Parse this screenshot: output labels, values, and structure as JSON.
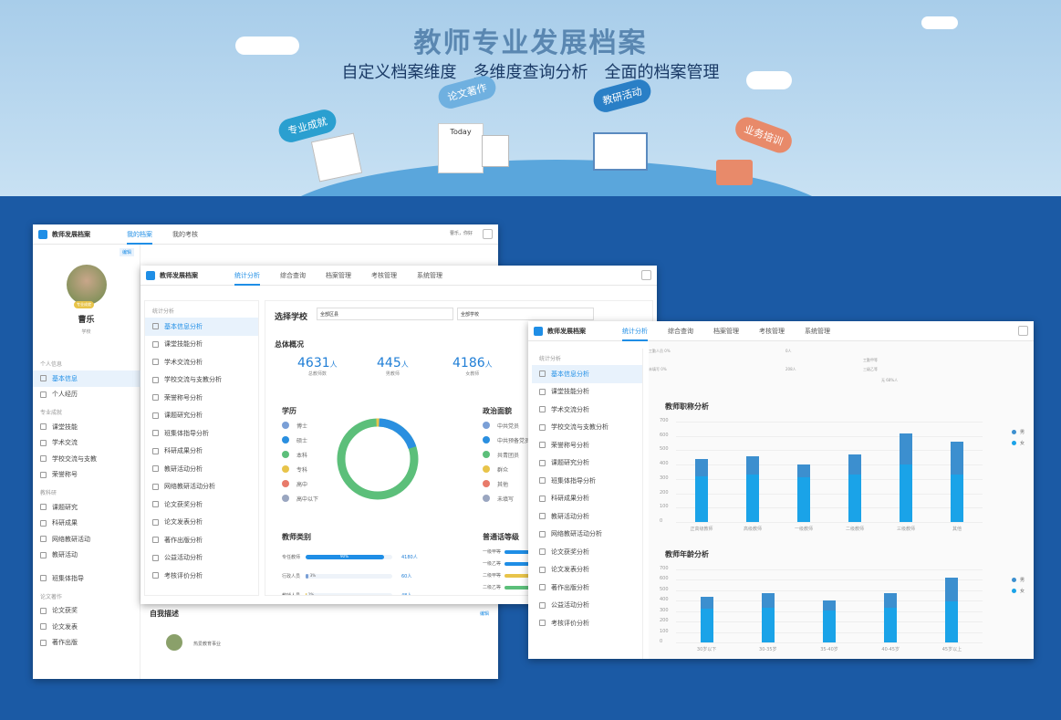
{
  "hero": {
    "title": "教师专业发展档案",
    "subtitle": "自定义档案维度　多维度查询分析　全面的档案管理",
    "bubbles": [
      "论文著作",
      "教研活动",
      "专业成就",
      "业务培训"
    ],
    "today": "Today"
  },
  "win1": {
    "brand": "教师发展档案",
    "tabs": [
      "我的档案",
      "我的考核"
    ],
    "user": "曹乐，你好",
    "tag": "编辑",
    "badge": "专业成就",
    "name": "曹乐",
    "school": "学校",
    "sections": [
      {
        "title": "个人信息",
        "items": [
          "基本信息",
          "个人经历"
        ]
      },
      {
        "title": "专业成就",
        "items": [
          "课堂技能",
          "学术交流",
          "学校交流与支教",
          "荣誉称号"
        ]
      },
      {
        "title": "教科研",
        "items": [
          "课题研究",
          "科研成果",
          "网络教研活动",
          "教研活动"
        ]
      },
      {
        "title": "",
        "items": [
          "班集体指导"
        ]
      },
      {
        "title": "论文著作",
        "items": [
          "论文获奖",
          "论文发表",
          "著作出版"
        ]
      }
    ],
    "self_title": "自我描述",
    "self_edit": "编辑",
    "self_text": "热爱教育事业"
  },
  "win2": {
    "brand": "教师发展档案",
    "tabs": [
      "统计分析",
      "综合查询",
      "档案管理",
      "考核管理",
      "系统管理"
    ],
    "menu_title": "统计分析",
    "menu": [
      "基本信息分析",
      "课堂技能分析",
      "学术交流分析",
      "学校交流与支教分析",
      "荣誉称号分析",
      "课题研究分析",
      "班集体指导分析",
      "科研成果分析",
      "教研活动分析",
      "网络教研活动分析",
      "论文获奖分析",
      "论文发表分析",
      "著作出版分析",
      "公益活动分析",
      "考核评价分析"
    ],
    "select_label": "选择学校",
    "select_district": "全部区县",
    "select_school": "全部学校",
    "overview": "总体概况",
    "kpis": [
      {
        "n": "4631",
        "u": "人",
        "l": "总教师数"
      },
      {
        "n": "445",
        "u": "人",
        "l": "男教师"
      },
      {
        "n": "4186",
        "u": "人",
        "l": "女教师"
      }
    ],
    "edu_title": "学历",
    "edu": [
      {
        "label": "博士",
        "color": "#7a9fd6"
      },
      {
        "label": "硕士",
        "color": "#2a8fe0"
      },
      {
        "label": "本科",
        "color": "#5cbf7a"
      },
      {
        "label": "专科",
        "color": "#e8c44a"
      },
      {
        "label": "高中",
        "color": "#e87a6a"
      },
      {
        "label": "高中以下",
        "color": "#9aa6c0"
      }
    ],
    "pol_title": "政治面貌",
    "pol": [
      {
        "label": "中共党员",
        "color": "#7a9fd6"
      },
      {
        "label": "中共预备党员",
        "color": "#2a8fe0"
      },
      {
        "label": "共青团员",
        "color": "#5cbf7a"
      },
      {
        "label": "群众",
        "color": "#e8c44a"
      },
      {
        "label": "其他",
        "color": "#e87a6a"
      },
      {
        "label": "未填写",
        "color": "#9aa6c0"
      }
    ],
    "type_title": "教师类别",
    "types": [
      {
        "label": "专任教师",
        "pct": "90%",
        "val": "4180人",
        "fill": 0.9,
        "color": "#1f8ee6"
      },
      {
        "label": "行政人员",
        "pct": "3%",
        "val": "60人",
        "fill": 0.03,
        "color": "#7a9fd6"
      },
      {
        "label": "教辅人员",
        "pct": "1%",
        "val": "48人",
        "fill": 0.01,
        "color": "#e8c44a"
      }
    ],
    "mand_title": "普通话等级",
    "mand": [
      {
        "label": "一级甲等",
        "val": "88人"
      },
      {
        "label": "一级乙等",
        "val": ""
      },
      {
        "label": "二级甲等",
        "val": ""
      },
      {
        "label": "二级乙等",
        "val": ""
      },
      {
        "label": "三级甲等",
        "val": ""
      }
    ]
  },
  "win3": {
    "brand": "教师发展档案",
    "tabs": [
      "统计分析",
      "综合查询",
      "档案管理",
      "考核管理",
      "系统管理"
    ],
    "menu_title": "统计分析",
    "menu": [
      "基本信息分析",
      "课堂技能分析",
      "学术交流分析",
      "学校交流与支教分析",
      "荣誉称号分析",
      "课题研究分析",
      "班集体指导分析",
      "科研成果分析",
      "教研活动分析",
      "网络教研活动分析",
      "论文获奖分析",
      "论文发表分析",
      "著作出版分析",
      "公益活动分析",
      "考核评价分析"
    ],
    "top_rows": [
      {
        "l": "工勤人员",
        "v": "0%"
      },
      {
        "l": "未填写",
        "v": "0%"
      }
    ],
    "top_vals": [
      "0人",
      "208人"
    ],
    "top_right": [
      {
        "l": "工勤甲等",
        "v": ""
      },
      {
        "l": "三级乙等",
        "v": ""
      },
      {
        "l": "无",
        "v": "68%人"
      }
    ],
    "legend": [
      "男",
      "女"
    ]
  },
  "chart_data": [
    {
      "type": "bar",
      "title": "教师职称分析",
      "categories": [
        "正高级教师",
        "高级教师",
        "一级教师",
        "二级教师",
        "三级教师",
        "其他"
      ],
      "ylim": [
        0,
        700
      ],
      "yticks": [
        0,
        100,
        200,
        300,
        400,
        500,
        600,
        700
      ],
      "series": [
        {
          "name": "男",
          "values": [
            120,
            130,
            90,
            140,
            220,
            230
          ]
        },
        {
          "name": "女",
          "values": [
            320,
            330,
            310,
            330,
            400,
            330
          ]
        }
      ]
    },
    {
      "type": "bar",
      "title": "教师年龄分析",
      "categories": [
        "30岁以下",
        "30-35岁",
        "35-40岁",
        "40-45岁",
        "45岁以上"
      ],
      "ylim": [
        0,
        700
      ],
      "yticks": [
        0,
        100,
        200,
        300,
        400,
        500,
        600,
        700
      ],
      "series": [
        {
          "name": "男",
          "values": [
            120,
            140,
            90,
            140,
            230
          ]
        },
        {
          "name": "女",
          "values": [
            320,
            330,
            310,
            330,
            390
          ]
        }
      ]
    }
  ]
}
